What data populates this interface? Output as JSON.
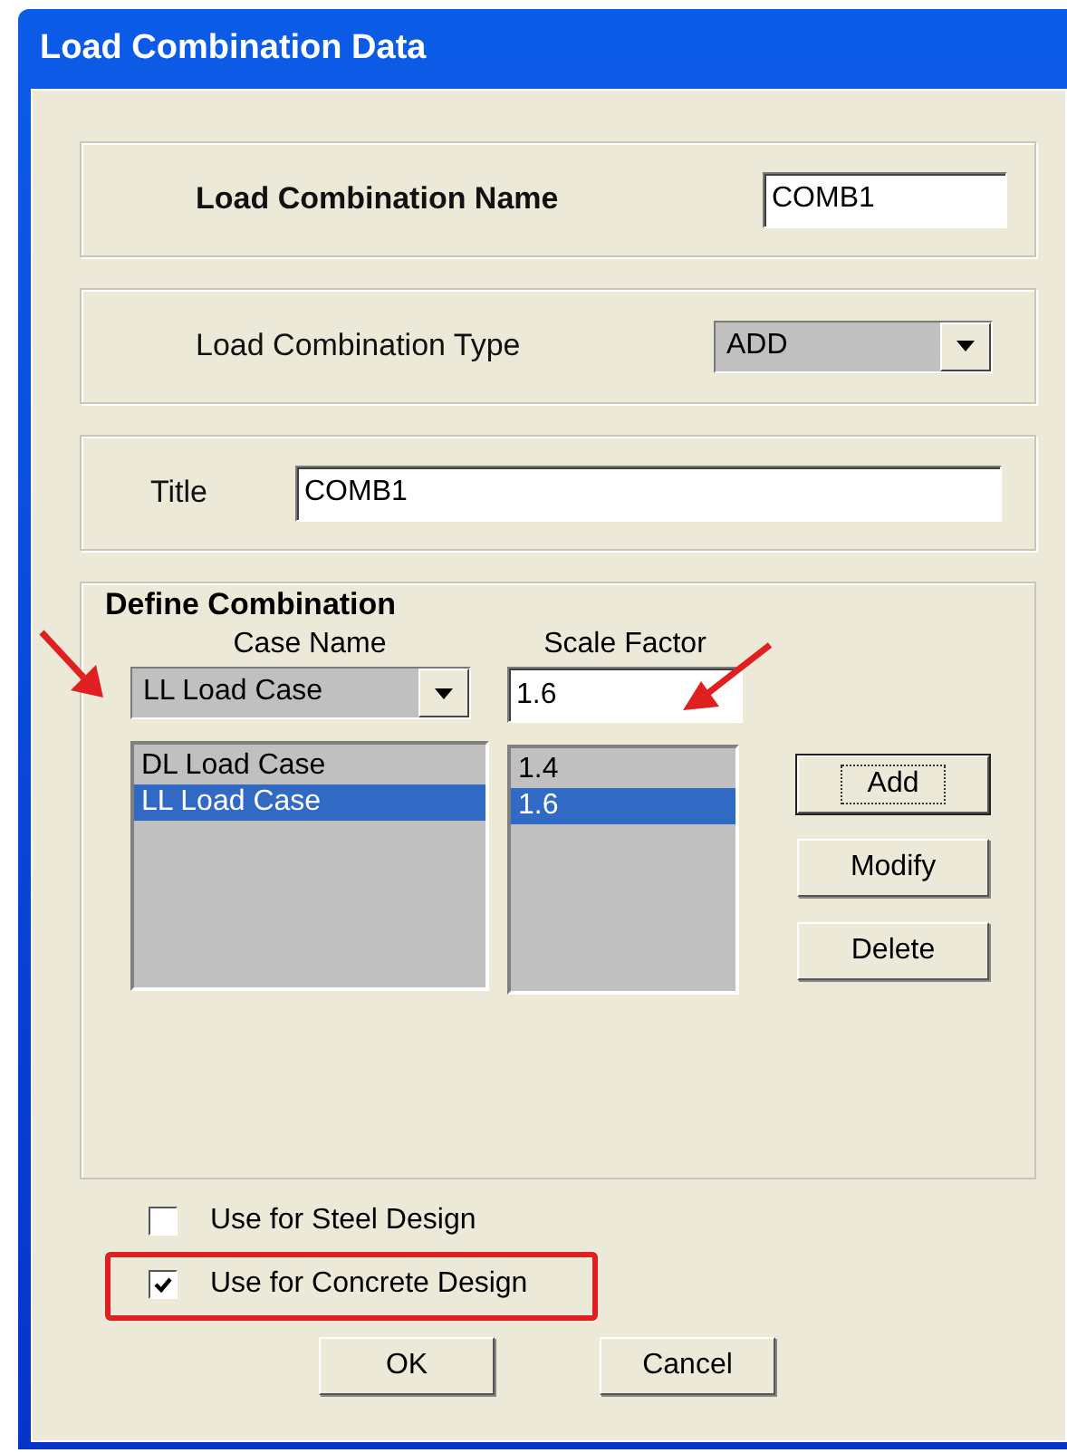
{
  "window": {
    "title": "Load Combination Data"
  },
  "name_field": {
    "label": "Load Combination Name",
    "value": "COMB1"
  },
  "type_field": {
    "label": "Load Combination Type",
    "value": "ADD"
  },
  "title_field": {
    "label": "Title",
    "value": "COMB1"
  },
  "define": {
    "heading": "Define Combination",
    "case_label": "Case Name",
    "case_value": "LL Load Case",
    "scale_label": "Scale Factor",
    "scale_value": "1.6",
    "rows": [
      {
        "case": "DL Load Case",
        "factor": "1.4",
        "selected": false
      },
      {
        "case": "LL Load Case",
        "factor": "1.6",
        "selected": true
      }
    ],
    "buttons": [
      {
        "label": "Add",
        "focused": true
      },
      {
        "label": "Modify",
        "focused": false
      },
      {
        "label": "Delete",
        "focused": false
      }
    ]
  },
  "options": [
    {
      "label": "Use for Steel Design",
      "checked": false,
      "highlighted": false
    },
    {
      "label": "Use for Concrete Design",
      "checked": true,
      "highlighted": true
    }
  ],
  "buttons": [
    {
      "label": "OK"
    },
    {
      "label": "Cancel"
    }
  ]
}
